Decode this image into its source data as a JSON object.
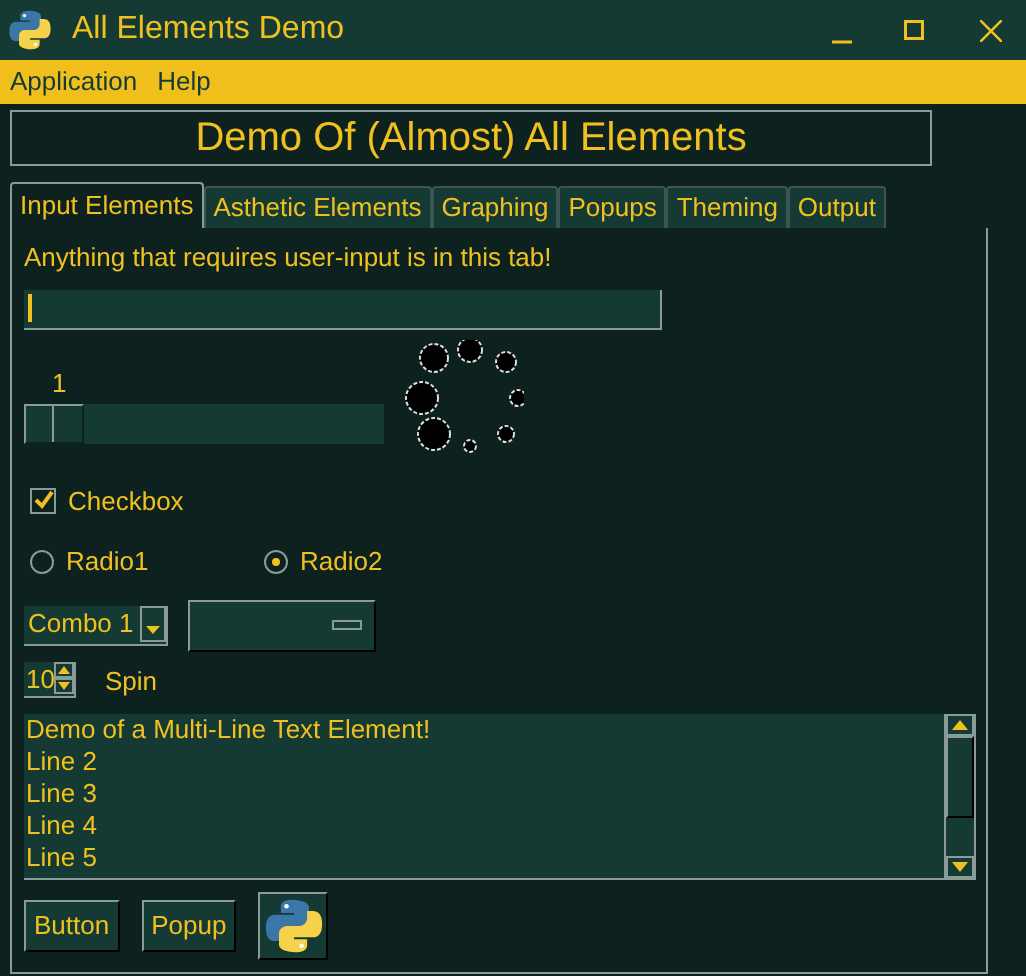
{
  "window": {
    "title": "All Elements Demo"
  },
  "menu": [
    "Application",
    "Help"
  ],
  "heading": "Demo Of (Almost) All Elements",
  "tabs": [
    {
      "label": "Input Elements",
      "selected": true
    },
    {
      "label": "Asthetic Elements",
      "selected": false
    },
    {
      "label": "Graphing",
      "selected": false
    },
    {
      "label": "Popups",
      "selected": false
    },
    {
      "label": "Theming",
      "selected": false
    },
    {
      "label": "Output",
      "selected": false
    }
  ],
  "intro": "Anything that requires user-input is in this tab!",
  "slider": {
    "reading": "1"
  },
  "checkbox": {
    "label": "Checkbox",
    "checked": true
  },
  "radios": [
    {
      "label": "Radio1",
      "selected": false
    },
    {
      "label": "Radio2",
      "selected": true
    }
  ],
  "combo": {
    "value": "Combo 1"
  },
  "spin": {
    "value": "10",
    "label": "Spin"
  },
  "multiline": [
    "Demo of a Multi-Line Text Element!",
    "Line 2",
    "Line 3",
    "Line 4",
    "Line 5"
  ],
  "buttons": [
    "Button",
    "Popup"
  ]
}
